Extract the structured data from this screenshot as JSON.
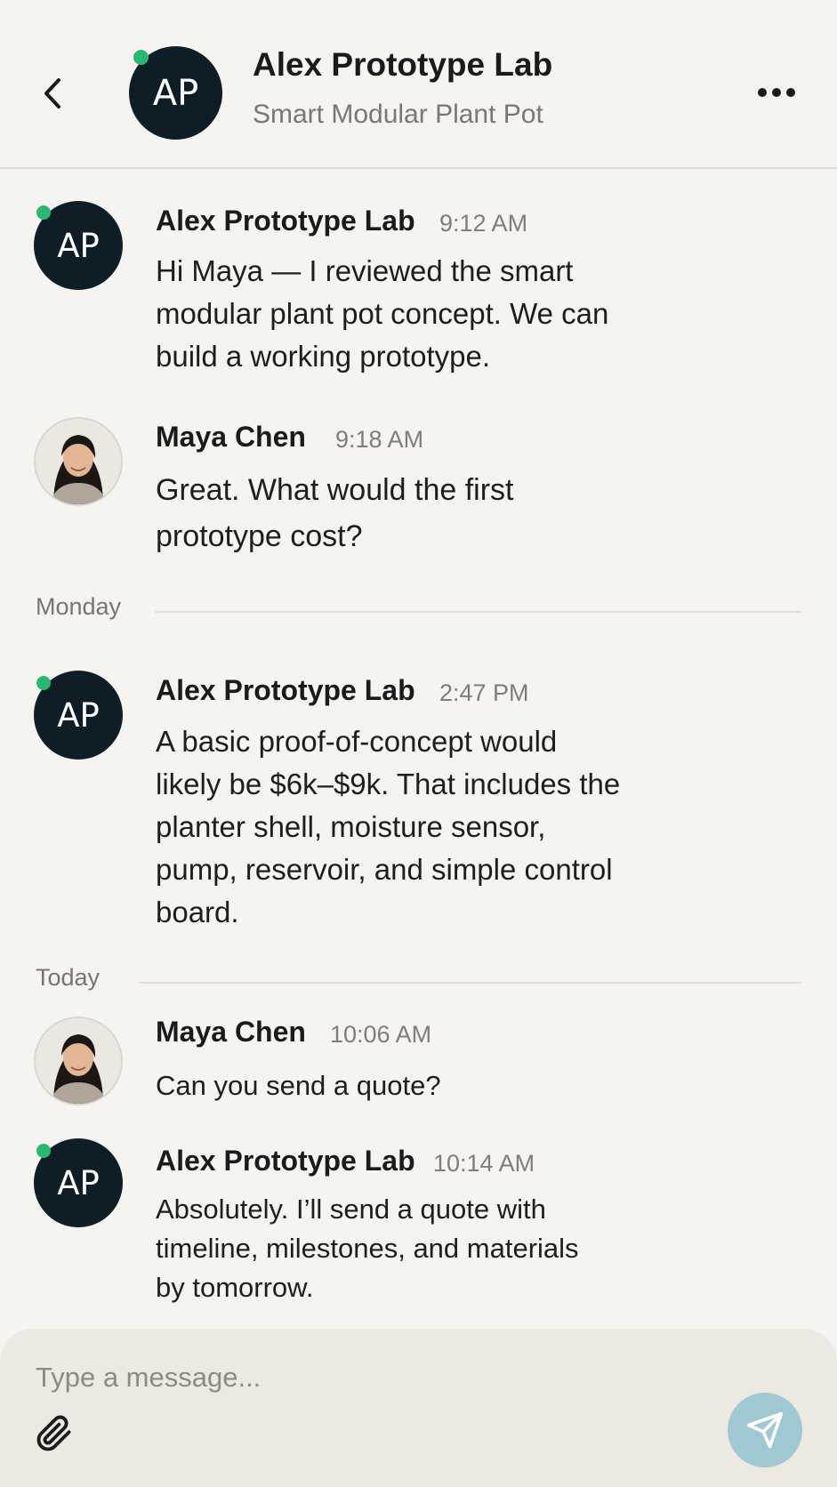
{
  "header": {
    "title": "Alex Prototype Lab",
    "subtitle": "Smart Modular Plant Pot",
    "avatar_initials": "AP",
    "back_icon": "chevron-left-icon",
    "more_icon": "more-horizontal-icon"
  },
  "messages": [
    {
      "sender": "Alex Prototype Lab",
      "initials": "AP",
      "time": "9:12 AM",
      "text": "Hi Maya — I reviewed the smart modular plant pot concept. We can build a working prototype."
    },
    {
      "sender": "Maya Chen",
      "time": "9:18 AM",
      "text": "Great. What would the first prototype cost?"
    },
    {
      "sender": "Alex Prototype Lab",
      "initials": "AP",
      "time": "2:47 PM",
      "text": "A basic proof-of-concept would likely be $6k–$9k. That includes the planter shell, moisture sensor, pump, reservoir, and simple control board."
    },
    {
      "sender": "Maya Chen",
      "time": "10:06 AM",
      "text": "Can you send a quote?"
    },
    {
      "sender": "Alex Prototype Lab",
      "initials": "AP",
      "time": "10:14 AM",
      "text": "Absolutely. I’ll send a quote with timeline, milestones, and materials by tomorrow."
    }
  ],
  "dividers": [
    "Monday",
    "Today"
  ],
  "composer": {
    "placeholder": "Type a message...",
    "attach_icon": "paperclip-icon",
    "send_icon": "send-icon"
  },
  "colors": {
    "background": "#f6f4f1",
    "avatar_dark": "#0f1e26",
    "online": "#2bb673",
    "send_button": "#9fc8d3",
    "composer_bg": "#ece8e2"
  }
}
